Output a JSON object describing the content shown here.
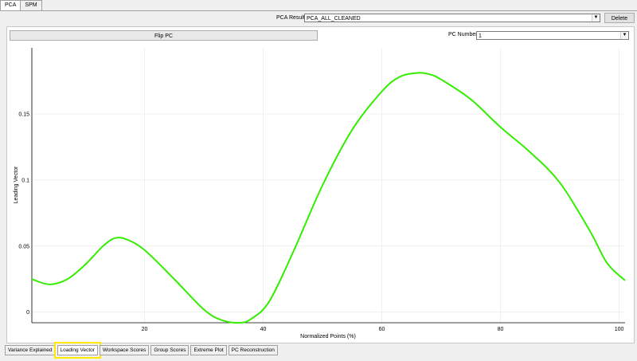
{
  "top_tabs": [
    {
      "label": "PCA",
      "active": true
    },
    {
      "label": "SPM",
      "active": false
    }
  ],
  "controls": {
    "pca_results_label": "PCA Results:",
    "pca_results_value": "PCA_ALL_CLEANED",
    "delete_label": "Delete",
    "flip_label": "Flip PC",
    "pc_number_label": "PC Number",
    "pc_number_value": "1"
  },
  "bottom_tabs": [
    {
      "label": "Variance Explained",
      "active": false
    },
    {
      "label": "Loading Vector",
      "active": true
    },
    {
      "label": "Workspace Scores",
      "active": false
    },
    {
      "label": "Group Scores",
      "active": false
    },
    {
      "label": "Extreme Plot",
      "active": false
    },
    {
      "label": "PC Reconstruction",
      "active": false
    }
  ],
  "colors": {
    "line": "#33ee00",
    "highlight": "#ffea00"
  },
  "chart_data": {
    "type": "line",
    "xlabel": "Normalized Points (%)",
    "ylabel": "Leading Vector",
    "xlim": [
      1,
      101
    ],
    "ylim": [
      -0.008,
      0.2
    ],
    "xticks": [
      20,
      40,
      60,
      80,
      100
    ],
    "yticks": [
      0,
      0.05,
      0.1,
      0.15
    ],
    "ytick_labels": [
      "0",
      "0.05",
      "0.1",
      "0.15"
    ],
    "grid": true,
    "series": [
      {
        "x": [
          1,
          4,
          7,
          10,
          13,
          15,
          17,
          20,
          25,
          30,
          33,
          36,
          38,
          41,
          45,
          50,
          55,
          60,
          63,
          66,
          68,
          70,
          75,
          80,
          85,
          90,
          95,
          98,
          101
        ],
        "y": [
          0.025,
          0.021,
          0.025,
          0.036,
          0.05,
          0.056,
          0.055,
          0.047,
          0.025,
          0.002,
          -0.006,
          -0.008,
          -0.005,
          0.008,
          0.045,
          0.096,
          0.138,
          0.167,
          0.178,
          0.181,
          0.18,
          0.176,
          0.161,
          0.14,
          0.121,
          0.098,
          0.062,
          0.037,
          0.024
        ]
      }
    ]
  }
}
